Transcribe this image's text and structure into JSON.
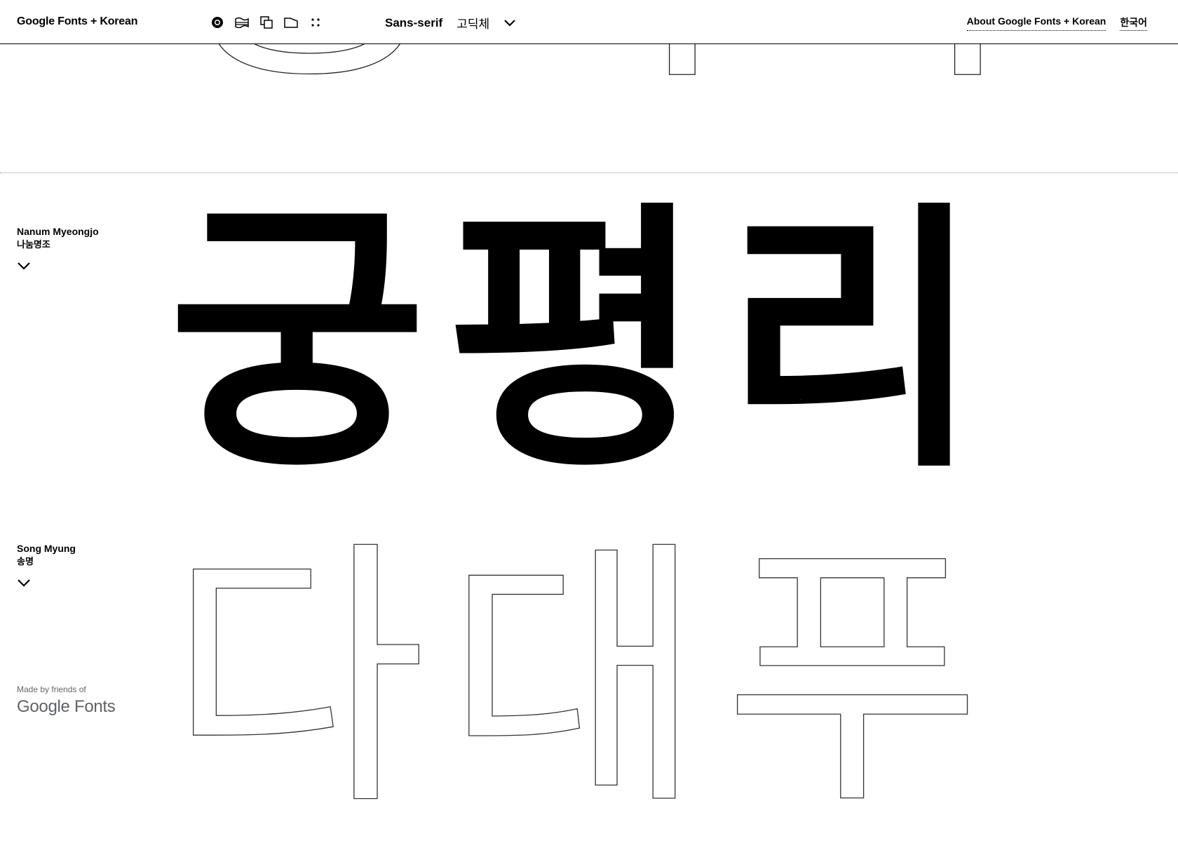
{
  "header": {
    "app_title": "Google Fonts + Korean",
    "view_modes": [
      {
        "name": "circle-view-icon"
      },
      {
        "name": "wave-flag-view-icon"
      },
      {
        "name": "layers-view-icon"
      },
      {
        "name": "folder-view-icon"
      },
      {
        "name": "grid-dots-view-icon"
      }
    ],
    "style_label_en": "Sans-serif",
    "style_label_ko": "고딕체",
    "about_link": "About Google Fonts + Korean",
    "language_link": "한국어"
  },
  "specimens": {
    "previous_glyphs": [
      "궁",
      "희",
      "기"
    ],
    "current": {
      "name_en": "Nanum Myeongjo",
      "name_ko": "나눔명조",
      "glyphs": [
        "궁",
        "평",
        "리"
      ]
    },
    "next": {
      "name_en": "Song Myung",
      "name_ko": "송명",
      "glyphs": [
        "다",
        "대",
        "푸"
      ]
    }
  },
  "footer": {
    "credit_text": "Made by friends of",
    "credit_logo": "Google Fonts"
  },
  "colors": {
    "background": "#ffffff",
    "foreground": "#000000",
    "credit_gray": "#5f6368"
  }
}
